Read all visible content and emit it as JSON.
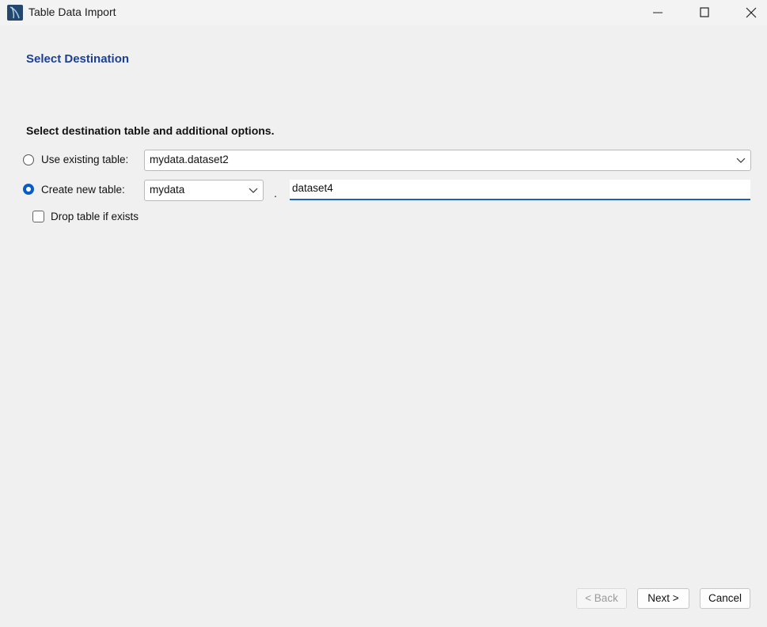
{
  "window": {
    "title": "Table Data Import"
  },
  "page": {
    "heading": "Select Destination",
    "instructions": "Select destination table and additional options."
  },
  "options": {
    "use_existing": {
      "label": "Use existing table:",
      "selected": false,
      "value": "mydata.dataset2"
    },
    "create_new": {
      "label": "Create new table:",
      "selected": true,
      "schema_value": "mydata",
      "separator": ".",
      "table_value": "dataset4"
    },
    "drop_if_exists": {
      "label": "Drop table if exists",
      "checked": false
    }
  },
  "buttons": {
    "back": "< Back",
    "next": "Next >",
    "cancel": "Cancel"
  },
  "colors": {
    "heading": "#1c3f94",
    "accent": "#0a5bc4",
    "input_underline": "#1a64b8"
  },
  "icons": {
    "app": "mysql-workbench-icon",
    "minimize": "minimize-icon",
    "maximize": "maximize-icon",
    "close": "close-icon",
    "dropdown": "chevron-down-icon"
  }
}
